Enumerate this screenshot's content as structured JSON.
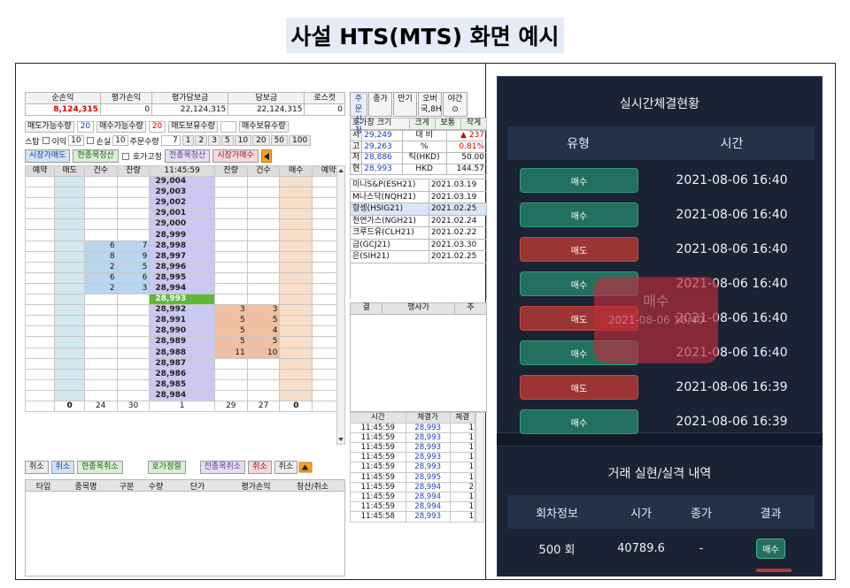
{
  "page_title": "사설 HTS(MTS) 화면 예시",
  "hts": {
    "summary_headers": [
      "순손익",
      "평가손익",
      "평가담보금",
      "담보금",
      "로스컷"
    ],
    "summary_values": [
      "8,124,315",
      "0",
      "22,124,315",
      "22,124,315",
      "0"
    ],
    "row3": {
      "sell_avail_label": "매도가능수량",
      "sell_avail_val": "20",
      "buy_avail_label": "매수가능수량",
      "buy_avail_val": "20",
      "sell_hold_label": "매도보유수량",
      "buy_hold_label": "매수보유수량"
    },
    "row4": {
      "stop_label": "스탑",
      "profit_label": "이익",
      "profit_val": "10",
      "loss_label": "손실",
      "loss_val": "10",
      "order_qty_label": "주문수량",
      "order_qty_val": "7",
      "qty_buttons": [
        "1",
        "2",
        "3",
        "5",
        "10",
        "20",
        "50",
        "100"
      ]
    },
    "row5": {
      "market_sell": "시장가매도",
      "cur_close": "현종목청산",
      "fix_label": "호가고정",
      "all_close": "전종목청산",
      "market_buy": "시장가매수"
    },
    "ladder_headers": [
      "예약",
      "매도",
      "건수",
      "잔량",
      "11:45:59",
      "잔량",
      "건수",
      "매수",
      "예약"
    ],
    "ladder": [
      {
        "price": "29,004",
        "sq": "",
        "sc": "",
        "bq": "",
        "bc": ""
      },
      {
        "price": "29,003",
        "sq": "",
        "sc": "",
        "bq": "",
        "bc": ""
      },
      {
        "price": "29,002",
        "sq": "",
        "sc": "",
        "bq": "",
        "bc": ""
      },
      {
        "price": "29,001",
        "sq": "",
        "sc": "",
        "bq": "",
        "bc": ""
      },
      {
        "price": "29,000",
        "sq": "",
        "sc": "",
        "bq": "",
        "bc": ""
      },
      {
        "price": "28,999",
        "sq": "",
        "sc": "",
        "bq": "",
        "bc": ""
      },
      {
        "price": "28,998",
        "sc": "6",
        "sq": "7",
        "bq": "",
        "bc": ""
      },
      {
        "price": "28,997",
        "sc": "8",
        "sq": "9",
        "bq": "",
        "bc": ""
      },
      {
        "price": "28,996",
        "sc": "2",
        "sq": "5",
        "bq": "",
        "bc": ""
      },
      {
        "price": "28,995",
        "sc": "6",
        "sq": "6",
        "bq": "",
        "bc": ""
      },
      {
        "price": "28,994",
        "sc": "2",
        "sq": "3",
        "bq": "",
        "bc": ""
      },
      {
        "price": "28,993",
        "sq": "",
        "sc": "",
        "bq": "",
        "bc": "",
        "current": true
      },
      {
        "price": "28,992",
        "sq": "",
        "sc": "",
        "bq": "3",
        "bc": "3"
      },
      {
        "price": "28,991",
        "sq": "",
        "sc": "",
        "bq": "5",
        "bc": "5"
      },
      {
        "price": "28,990",
        "sq": "",
        "sc": "",
        "bq": "5",
        "bc": "4"
      },
      {
        "price": "28,989",
        "sq": "",
        "sc": "",
        "bq": "5",
        "bc": "5"
      },
      {
        "price": "28,988",
        "sq": "",
        "sc": "",
        "bq": "11",
        "bc": "10"
      },
      {
        "price": "28,987",
        "sq": "",
        "sc": "",
        "bq": "",
        "bc": ""
      },
      {
        "price": "28,986",
        "sq": "",
        "sc": "",
        "bq": "",
        "bc": ""
      },
      {
        "price": "28,985",
        "sq": "",
        "sc": "",
        "bq": "",
        "bc": ""
      },
      {
        "price": "28,984",
        "sq": "",
        "sc": "",
        "bq": "",
        "bc": ""
      }
    ],
    "ladder_totals": [
      "0",
      "24",
      "30",
      "1",
      "29",
      "27",
      "0"
    ],
    "bottom_buttons": [
      "취소",
      "취소",
      "현종목취소",
      "호가정렬",
      "전종목취소",
      "취소",
      "취소"
    ],
    "holdings_headers": [
      "타입",
      "종목명",
      "구분",
      "수량",
      "단가",
      "평가손익",
      "청산/취소"
    ],
    "right": {
      "top_buttons": [
        "주문\n신청",
        "종가",
        "만기",
        "오버",
        "야간"
      ],
      "sub_vals": [
        "국,8H",
        "⊙"
      ],
      "size_label": "호가창 크기",
      "size_buttons": [
        "크게",
        "보통",
        "작게"
      ],
      "quote": [
        [
          "시",
          "29,249",
          "대 비",
          "▲ 237"
        ],
        [
          "고",
          "29,263",
          "%",
          "0.81%"
        ],
        [
          "저",
          "28,886",
          "틱(HKD)",
          "50.00"
        ],
        [
          "현",
          "28,993",
          "HKD",
          "144.57"
        ]
      ],
      "futures": [
        [
          "미니S&P(ESH21)",
          "2021.03.19"
        ],
        [
          "M나스닥(NQH21)",
          "2021.03.19"
        ],
        [
          "항셍(HSIG21)",
          "2021.02.25"
        ],
        [
          "천연가스(NGH21)",
          "2021.02.24"
        ],
        [
          "크루드유(CLH21)",
          "2021.02.22"
        ],
        [
          "금(GCJ21)",
          "2021.03.30"
        ],
        [
          "은(SIH21)",
          "2021.02.25"
        ]
      ],
      "mid_headers": [
        "결",
        "행사가",
        "추"
      ],
      "tick_headers": [
        "시간",
        "체결가",
        "체결"
      ],
      "ticks": [
        [
          "11:45:59",
          "28,993",
          "1"
        ],
        [
          "11:45:59",
          "28,993",
          "1"
        ],
        [
          "11:45:59",
          "28,993",
          "1"
        ],
        [
          "11:45:59",
          "28,993",
          "1"
        ],
        [
          "11:45:59",
          "28,993",
          "1"
        ],
        [
          "11:45:59",
          "28,995",
          "1"
        ],
        [
          "11:45:59",
          "28,994",
          "2"
        ],
        [
          "11:45:59",
          "28,994",
          "1"
        ],
        [
          "11:45:59",
          "28,994",
          "1"
        ],
        [
          "11:45:58",
          "28,993",
          "1"
        ]
      ]
    }
  },
  "mts": {
    "live_title": "실시간체결현황",
    "col_type": "유형",
    "col_time": "시간",
    "rows": [
      {
        "type": "매수",
        "kind": "buy",
        "time": "2021-08-06 16:40"
      },
      {
        "type": "매수",
        "kind": "buy",
        "time": "2021-08-06 16:40"
      },
      {
        "type": "매도",
        "kind": "sell",
        "time": "2021-08-06 16:40"
      },
      {
        "type": "매수",
        "kind": "buy",
        "time": "2021-08-06 16:40"
      },
      {
        "type": "매도",
        "kind": "sell",
        "time": "2021-08-06 16:40"
      },
      {
        "type": "매수",
        "kind": "buy",
        "time": "2021-08-06 16:40"
      },
      {
        "type": "매도",
        "kind": "sell",
        "time": "2021-08-06 16:39"
      },
      {
        "type": "매수",
        "kind": "buy",
        "time": "2021-08-06 16:39"
      }
    ],
    "overlay_type": "매수",
    "overlay_time": "2021-08-06 16:40",
    "history_title": "거래 실현/실격 내역",
    "history_headers": [
      "회차정보",
      "시가",
      "종가",
      "결과"
    ],
    "history_row": {
      "round": "500 회",
      "open": "40789.6",
      "close": "-",
      "result": "매수"
    },
    "colors": {
      "buy": "#23705f",
      "sell": "#9a3533",
      "bg": "#1a2233",
      "header": "#233149"
    }
  }
}
